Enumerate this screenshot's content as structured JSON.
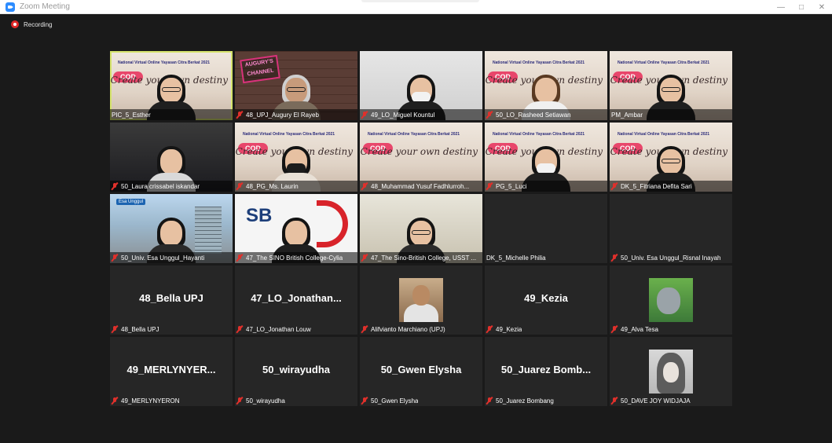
{
  "window": {
    "title": "Zoom Meeting",
    "minimize_glyph": "—",
    "maximize_glyph": "□",
    "close_glyph": "✕"
  },
  "recording": {
    "label": "Recording"
  },
  "colors": {
    "active_speaker_border": "#d5e36c",
    "mute_icon": "#e0302b",
    "recording": "#e02828",
    "tile_background": "#262626"
  },
  "cod_banner": {
    "title": "National Virtual Online Yayasan Citra Berkat 2021",
    "badge": "COD",
    "tagline": "Create your own destiny"
  },
  "tiles": [
    {
      "caption": "PIC_5_Esther",
      "muted": false,
      "active": true
    },
    {
      "caption": "48_UPJ_Augury El Rayeb",
      "muted": true,
      "overlay": "AUGURY'S CHANNEL"
    },
    {
      "caption": "49_LO_Miguel Kountul",
      "muted": true
    },
    {
      "caption": "50_LO_Rasheed Setiawan",
      "muted": true
    },
    {
      "caption": "PM_Ambar",
      "muted": false
    },
    {
      "caption": "50_Laura crissabel iskandar",
      "muted": true
    },
    {
      "caption": "48_PG_Ms. Laurin",
      "muted": true
    },
    {
      "caption": "48_Muhammad Yusuf Fadhlurroh...",
      "muted": true
    },
    {
      "caption": "PG_5_Luci",
      "muted": true
    },
    {
      "caption": "DK_5_Fitriana Defita Sari",
      "muted": true
    },
    {
      "caption": "50_Univ. Esa Unggul_Hayanti",
      "muted": true,
      "overlay": "Esa Unggul"
    },
    {
      "caption": "47_The SINO British College-Cylia",
      "muted": true,
      "overlay": "SB"
    },
    {
      "caption": "47_The Sino-British College, USST ...",
      "muted": true
    },
    {
      "caption": "DK_5_Michelle Philia",
      "muted": false
    },
    {
      "caption": "50_Univ. Esa Unggul_Risnal Inayah",
      "muted": true
    },
    {
      "caption": "48_Bella UPJ",
      "display_name": "48_Bella UPJ",
      "muted": true
    },
    {
      "caption": "47_LO_Jonathan Louw",
      "display_name": "47_LO_Jonathan...",
      "muted": true
    },
    {
      "caption": "Alifvianto Marchiano (UPJ)",
      "muted": true
    },
    {
      "caption": "49_Kezia",
      "display_name": "49_Kezia",
      "muted": true
    },
    {
      "caption": "49_Alva Tesa",
      "muted": true
    },
    {
      "caption": "49_MERLYNYERON",
      "display_name": "49_MERLYNYER...",
      "muted": true
    },
    {
      "caption": "50_wirayudha",
      "display_name": "50_wirayudha",
      "muted": true
    },
    {
      "caption": "50_Gwen Elysha",
      "display_name": "50_Gwen Elysha",
      "muted": true
    },
    {
      "caption": "50_Juarez Bombang",
      "display_name": "50_Juarez Bomb...",
      "muted": true
    },
    {
      "caption": "50_DAVE JOY WIDJAJA",
      "muted": true
    }
  ]
}
